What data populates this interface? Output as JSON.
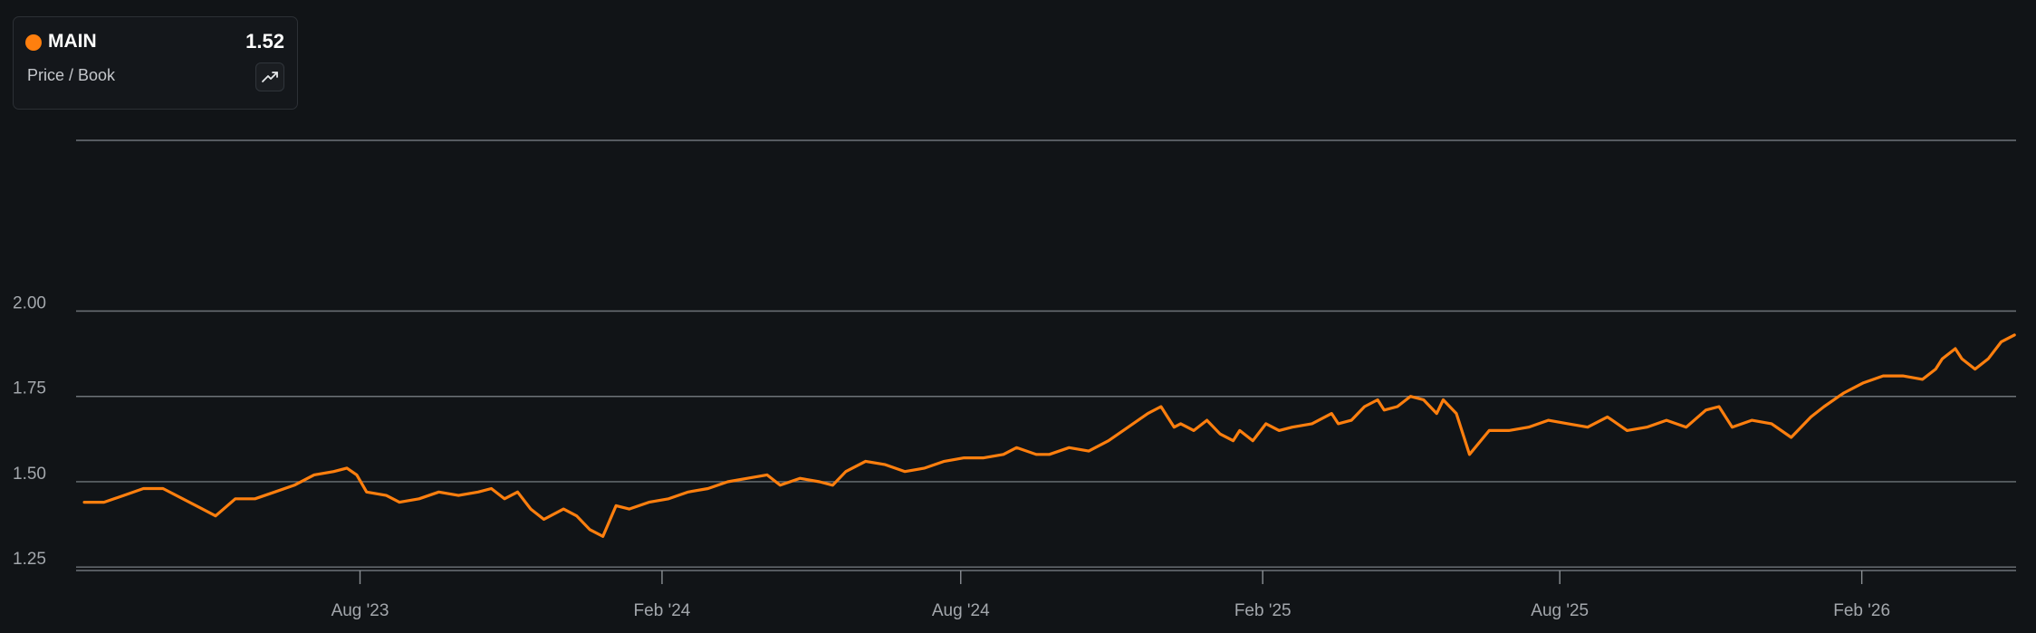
{
  "legend": {
    "ticker": "MAIN",
    "value": "1.52",
    "metric": "Price / Book",
    "trend_icon": "trend-up-icon",
    "series_color": "#ff7f0e"
  },
  "chart_data": {
    "type": "line",
    "ylabel": "",
    "xlabel": "",
    "ylim": [
      1.24,
      2.5
    ],
    "y_ticks": [
      2.0,
      1.75,
      1.5,
      1.25
    ],
    "y_tick_labels": [
      "2.00",
      "1.75",
      "1.50",
      "1.25"
    ],
    "grid": true,
    "x_ticks": [
      {
        "date": "2023-08-01",
        "label": "Aug '23"
      },
      {
        "date": "2024-02-01",
        "label": "Feb '24"
      },
      {
        "date": "2024-08-01",
        "label": "Aug '24"
      },
      {
        "date": "2025-02-01",
        "label": "Feb '25"
      },
      {
        "date": "2025-08-01",
        "label": "Aug '25"
      },
      {
        "date": "2026-02-01",
        "label": "Feb '26"
      }
    ],
    "xlim": [
      "2023-02-09",
      "2026-05-06"
    ],
    "series": [
      {
        "name": "MAIN",
        "color": "#ff7f0e",
        "points": [
          [
            "2023-02-14",
            1.44
          ],
          [
            "2023-02-26",
            1.44
          ],
          [
            "2023-03-10",
            1.46
          ],
          [
            "2023-03-22",
            1.48
          ],
          [
            "2023-04-03",
            1.48
          ],
          [
            "2023-04-15",
            1.45
          ],
          [
            "2023-04-27",
            1.42
          ],
          [
            "2023-05-05",
            1.4
          ],
          [
            "2023-05-17",
            1.45
          ],
          [
            "2023-05-29",
            1.45
          ],
          [
            "2023-06-10",
            1.47
          ],
          [
            "2023-06-22",
            1.49
          ],
          [
            "2023-07-04",
            1.52
          ],
          [
            "2023-07-16",
            1.53
          ],
          [
            "2023-07-24",
            1.54
          ],
          [
            "2023-07-30",
            1.52
          ],
          [
            "2023-08-05",
            1.47
          ],
          [
            "2023-08-17",
            1.46
          ],
          [
            "2023-08-25",
            1.44
          ],
          [
            "2023-09-06",
            1.45
          ],
          [
            "2023-09-18",
            1.47
          ],
          [
            "2023-09-30",
            1.46
          ],
          [
            "2023-10-12",
            1.47
          ],
          [
            "2023-10-20",
            1.48
          ],
          [
            "2023-10-28",
            1.45
          ],
          [
            "2023-11-05",
            1.47
          ],
          [
            "2023-11-13",
            1.42
          ],
          [
            "2023-11-21",
            1.39
          ],
          [
            "2023-12-03",
            1.42
          ],
          [
            "2023-12-11",
            1.4
          ],
          [
            "2023-12-19",
            1.36
          ],
          [
            "2023-12-27",
            1.34
          ],
          [
            "2024-01-04",
            1.43
          ],
          [
            "2024-01-12",
            1.42
          ],
          [
            "2024-01-24",
            1.44
          ],
          [
            "2024-02-05",
            1.45
          ],
          [
            "2024-02-17",
            1.47
          ],
          [
            "2024-02-29",
            1.48
          ],
          [
            "2024-03-12",
            1.5
          ],
          [
            "2024-03-24",
            1.51
          ],
          [
            "2024-04-05",
            1.52
          ],
          [
            "2024-04-13",
            1.49
          ],
          [
            "2024-04-25",
            1.51
          ],
          [
            "2024-05-07",
            1.5
          ],
          [
            "2024-05-15",
            1.49
          ],
          [
            "2024-05-23",
            1.53
          ],
          [
            "2024-06-04",
            1.56
          ],
          [
            "2024-06-16",
            1.55
          ],
          [
            "2024-06-28",
            1.53
          ],
          [
            "2024-07-10",
            1.54
          ],
          [
            "2024-07-22",
            1.56
          ],
          [
            "2024-08-03",
            1.57
          ],
          [
            "2024-08-15",
            1.57
          ],
          [
            "2024-08-27",
            1.58
          ],
          [
            "2024-09-04",
            1.6
          ],
          [
            "2024-09-16",
            1.58
          ],
          [
            "2024-09-24",
            1.58
          ],
          [
            "2024-10-06",
            1.6
          ],
          [
            "2024-10-18",
            1.59
          ],
          [
            "2024-10-30",
            1.62
          ],
          [
            "2024-11-11",
            1.66
          ],
          [
            "2024-11-23",
            1.7
          ],
          [
            "2024-12-01",
            1.72
          ],
          [
            "2024-12-05",
            1.69
          ],
          [
            "2024-12-09",
            1.66
          ],
          [
            "2024-12-13",
            1.67
          ],
          [
            "2024-12-21",
            1.65
          ],
          [
            "2024-12-29",
            1.68
          ],
          [
            "2025-01-06",
            1.64
          ],
          [
            "2025-01-14",
            1.62
          ],
          [
            "2025-01-18",
            1.65
          ],
          [
            "2025-01-26",
            1.62
          ],
          [
            "2025-02-03",
            1.67
          ],
          [
            "2025-02-11",
            1.65
          ],
          [
            "2025-02-19",
            1.66
          ],
          [
            "2025-03-03",
            1.67
          ],
          [
            "2025-03-15",
            1.7
          ],
          [
            "2025-03-19",
            1.67
          ],
          [
            "2025-03-27",
            1.68
          ],
          [
            "2025-04-04",
            1.72
          ],
          [
            "2025-04-12",
            1.74
          ],
          [
            "2025-04-16",
            1.71
          ],
          [
            "2025-04-24",
            1.72
          ],
          [
            "2025-05-02",
            1.75
          ],
          [
            "2025-05-10",
            1.74
          ],
          [
            "2025-05-18",
            1.7
          ],
          [
            "2025-05-22",
            1.74
          ],
          [
            "2025-05-30",
            1.7
          ],
          [
            "2025-06-07",
            1.58
          ],
          [
            "2025-06-19",
            1.65
          ],
          [
            "2025-07-01",
            1.65
          ],
          [
            "2025-07-13",
            1.66
          ],
          [
            "2025-07-25",
            1.68
          ],
          [
            "2025-08-06",
            1.67
          ],
          [
            "2025-08-18",
            1.66
          ],
          [
            "2025-08-30",
            1.69
          ],
          [
            "2025-09-11",
            1.65
          ],
          [
            "2025-09-23",
            1.66
          ],
          [
            "2025-10-05",
            1.68
          ],
          [
            "2025-10-17",
            1.66
          ],
          [
            "2025-10-29",
            1.71
          ],
          [
            "2025-11-06",
            1.72
          ],
          [
            "2025-11-14",
            1.66
          ],
          [
            "2025-11-26",
            1.68
          ],
          [
            "2025-12-08",
            1.67
          ],
          [
            "2025-12-20",
            1.63
          ],
          [
            "2026-01-01",
            1.69
          ],
          [
            "2026-01-09",
            1.72
          ],
          [
            "2026-01-21",
            1.76
          ],
          [
            "2026-02-02",
            1.79
          ],
          [
            "2026-02-14",
            1.81
          ],
          [
            "2026-02-26",
            1.81
          ],
          [
            "2026-03-10",
            1.8
          ],
          [
            "2026-03-18",
            1.83
          ],
          [
            "2026-03-22",
            1.86
          ],
          [
            "2026-03-30",
            1.89
          ],
          [
            "2026-04-03",
            1.86
          ],
          [
            "2026-04-11",
            1.83
          ],
          [
            "2026-04-19",
            1.86
          ],
          [
            "2026-04-27",
            1.91
          ],
          [
            "2026-05-05",
            1.93
          ]
        ]
      }
    ]
  }
}
